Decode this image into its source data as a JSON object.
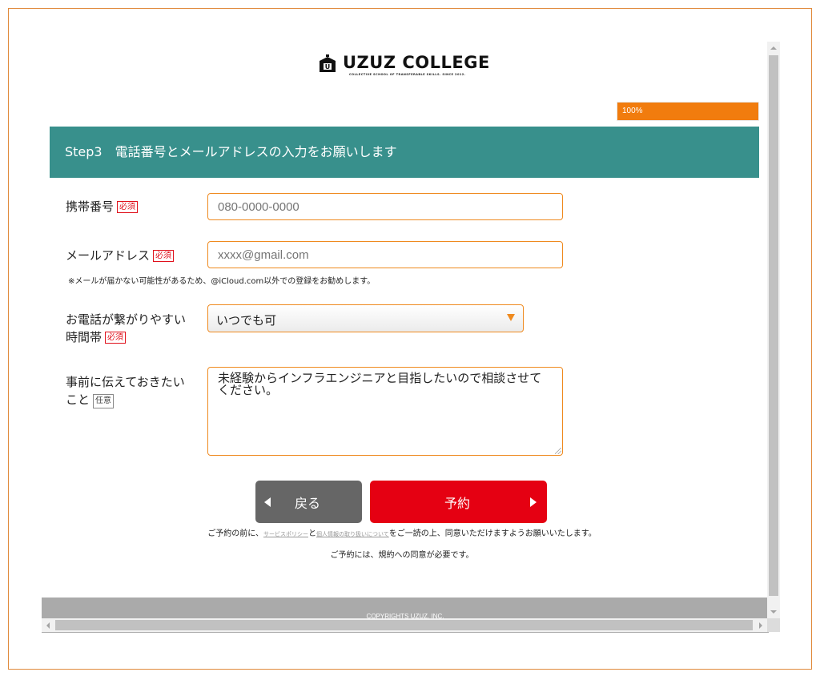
{
  "header": {
    "logo_title": "UZUZ COLLEGE",
    "logo_subtitle": "COLLECTIVE SCHOOL OF TRANSFERABLE SKILLS. SINCE 2012.",
    "logo_icon": "building-icon"
  },
  "progress": {
    "value": 1.0,
    "label": "100%",
    "color": "#f17c0e"
  },
  "step": {
    "title": "Step3　電話番号とメールアドレスの入力をお願いします",
    "banner_color": "#38908c"
  },
  "form": {
    "phone": {
      "label": "携帯番号",
      "badge": "必須",
      "placeholder": "080-0000-0000"
    },
    "email": {
      "label": "メールアドレス",
      "badge": "必須",
      "placeholder": "xxxx@gmail.com",
      "note": "※メールが届かない可能性があるため、@iCloud.com以外での登録をお勧めします。"
    },
    "call_time": {
      "label_line1": "お電話が繋がりやすい",
      "label_line2": "時間帯",
      "badge": "必須",
      "selected": "いつでも可"
    },
    "message": {
      "label_line1": "事前に伝えておきたい",
      "label_line2": "こと",
      "badge": "任意",
      "value": "未経験からインフラエンジニアと目指したいので相談させてください。"
    }
  },
  "buttons": {
    "back_label": "戻る",
    "reserve_label": "予約",
    "reserve_color": "#e50012",
    "back_color": "#666666"
  },
  "consent": {
    "prefix": "ご予約の前に、",
    "service_policy_link": "サービスポリシー",
    "and": "と",
    "privacy_link": "個人情報の取り扱いについて",
    "suffix": "をご一読の上、同意いただけますようお願いいたします。",
    "line2": "ご予約には、規約への同意が必要です。"
  },
  "footer": {
    "copyright": "COPYRIGHTS UZUZ, INC."
  }
}
